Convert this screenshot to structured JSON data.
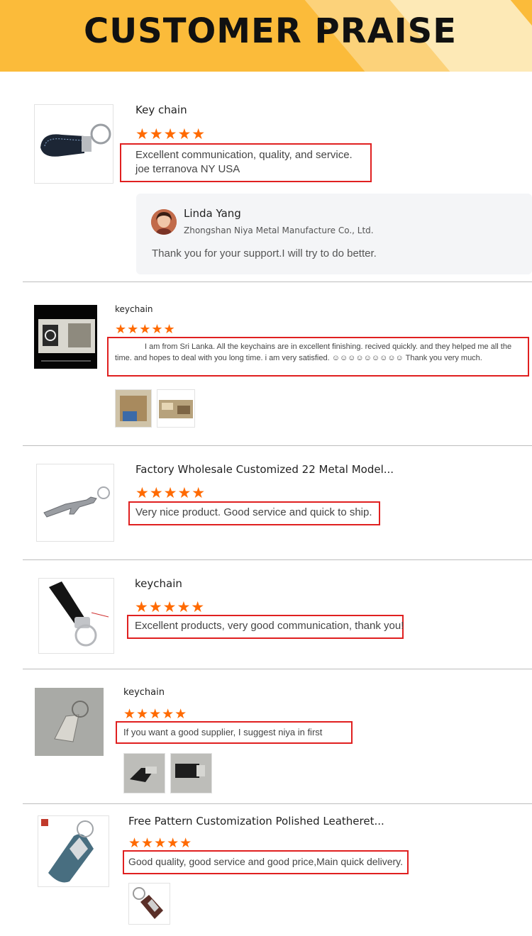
{
  "header": {
    "title": "CUSTOMER PRAISE"
  },
  "colors": {
    "banner": "#fbbb3a",
    "star": "#ff6a00",
    "highlight_box": "#e02020"
  },
  "rating_stars": "★★★★★",
  "reviews": [
    {
      "title": "Key chain",
      "rating": 5,
      "comment_line1": "Excellent communication, quality, and service.",
      "comment_line2": "joe terranova NY USA"
    },
    {
      "title": "keychain",
      "rating": 5,
      "comment": "I am from Sri Lanka. All the keychains are in excellent finishing. recived quickly. and they helped me all the time. and hopes to deal with you long time. i am very satisfied. ☺☺☺☺☺☺☺☺☺ Thank you very much."
    },
    {
      "title": "Factory Wholesale Customized 22 Metal Model...",
      "rating": 5,
      "comment": "Very nice product. Good service and quick to ship."
    },
    {
      "title": "keychain",
      "rating": 5,
      "comment": "Excellent products, very good communication, thank you!"
    },
    {
      "title": "keychain",
      "rating": 5,
      "comment": "If you want a good supplier, I suggest niya in first"
    },
    {
      "title": "Free Pattern Customization Polished Leatheret...",
      "rating": 5,
      "comment": "Good quality, good service and good price,Main quick delivery."
    }
  ],
  "seller_reply": {
    "name": "Linda Yang",
    "company": "Zhongshan Niya Metal Manufacture Co., Ltd.",
    "message": "Thank you for your support.I will try to do better."
  }
}
